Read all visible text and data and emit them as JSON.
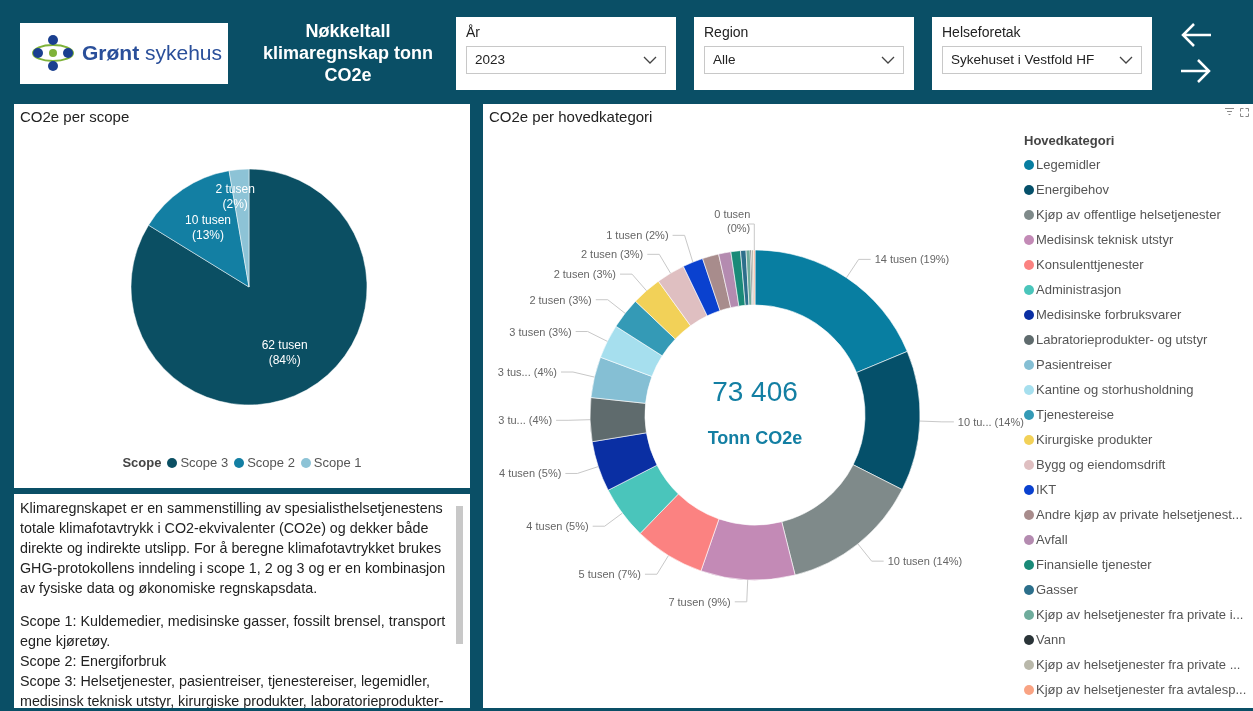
{
  "header": {
    "logo_text": "**Grønt** sykehus",
    "title": "Nøkkeltall klimaregnskap tonn CO2e"
  },
  "filters": [
    {
      "label": "År",
      "value": "2023"
    },
    {
      "label": "Region",
      "value": "Alle"
    },
    {
      "label": "Helseforetak",
      "value": "Sykehuset i Vestfold HF"
    }
  ],
  "scope_panel": {
    "title": "CO2e per scope",
    "legend_title": "Scope",
    "chart_data": {
      "type": "pie",
      "categories": [
        "Scope 3",
        "Scope 2",
        "Scope 1"
      ],
      "values": [
        62,
        10,
        2
      ],
      "colors": [
        "#0b4f63",
        "#137fa3",
        "#8dc3d6"
      ],
      "value_labels": [
        "62 tusen (84%)",
        "10 tusen (13%)",
        "2 tusen (2%)"
      ]
    }
  },
  "description": {
    "paragraphs": [
      "Klimaregnskapet er en sammenstilling av spesialisthelsetjenestens totale klimafotavtrykk i CO2-ekvivalenter (CO2e) og dekker både direkte og indirekte utslipp. For å beregne klimafotavtrykket brukes GHG-protokollens inndeling i scope 1, 2 og 3 og er en kombinasjon av fysiske data og økonomiske regnskapsdata."
    ],
    "lines": [
      "Scope 1: Kuldemedier, medisinske gasser, fossilt brensel, transport egne kjøretøy.",
      "Scope 2: Energiforbruk",
      "Scope 3: Helsetjenester, pasientreiser, tjenestereiser, legemidler, medisinsk teknisk utstyr, kirurgiske produkter, laboratorieprodukter-"
    ]
  },
  "category_panel": {
    "title": "CO2e per hovedkategori",
    "total": "73 406",
    "total_unit": "Tonn CO2e",
    "legend_title": "Hovedkategori",
    "chart_data": {
      "type": "donut",
      "categories": [
        "Legemidler",
        "Energibehov",
        "Kjøp av offentlige helsetjenester",
        "Medisinsk teknisk utstyr",
        "Konsulenttjenester",
        "Administrasjon",
        "Medisinske forbruksvarer",
        "Labratorieprodukter- og utstyr",
        "Pasientreiser",
        "Kantine og storhusholdning",
        "Tjenestereise",
        "Kirurgiske produkter",
        "Bygg og eiendomsdrift",
        "IKT",
        "Andre kjøp av private helsetjenest...",
        "Avfall",
        "Finansielle tjenester",
        "Gasser",
        "Kjøp av helsetjenester fra private i...",
        "Vann",
        "Kjøp av helsetjenester fra private ...",
        "Kjøp av helsetjenester fra avtalesp..."
      ],
      "values": [
        14,
        10.3,
        10.2,
        6.9,
        5.2,
        3.9,
        3.7,
        3.2,
        3.0,
        2.5,
        2.3,
        2.2,
        2.1,
        1.5,
        1.2,
        0.9,
        0.7,
        0.4,
        0.3,
        0.1,
        0.15,
        0.1
      ],
      "colors": [
        "#087ea1",
        "#05506a",
        "#7f8a8a",
        "#c38ab6",
        "#fb8281",
        "#4ac5bb",
        "#0a2fa3",
        "#5f6b6d",
        "#85bfd4",
        "#a6dfee",
        "#349ab6",
        "#f2d158",
        "#dfbfc1",
        "#0a41cf",
        "#a88c8c",
        "#b48bb0",
        "#1a8a78",
        "#2c6f8b",
        "#6fac9c",
        "#2a3438",
        "#b9b8aa",
        "#f9a383"
      ],
      "value_labels": [
        "14 tusen (19%)",
        "10 tu... (14%)",
        "10 tusen (14%)",
        "7 tusen (9%)",
        "5 tusen (7%)",
        "4 tusen (5%)",
        "4 tusen (5%)",
        "3 tu... (4%)",
        "3 tus... (4%)",
        "3 tusen (3%)",
        "2 tusen (3%)",
        "2 tusen (3%)",
        "2 tusen (3%)",
        "1 tusen (2%)",
        null,
        null,
        null,
        null,
        null,
        null,
        null,
        "0 tusen (0%)"
      ]
    }
  }
}
